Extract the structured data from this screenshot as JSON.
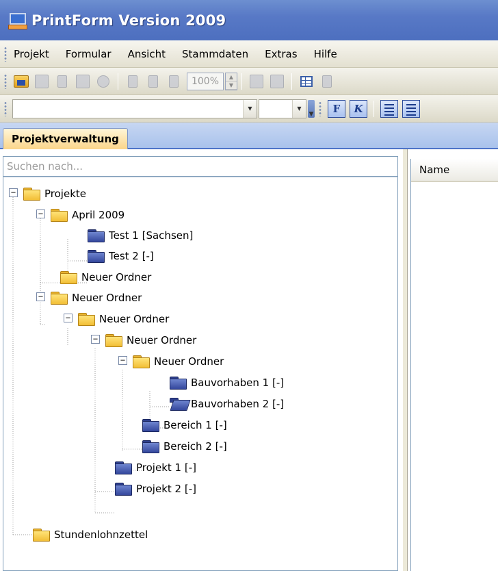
{
  "window": {
    "title": "PrintForm Version 2009"
  },
  "menu": [
    "Projekt",
    "Formular",
    "Ansicht",
    "Stammdaten",
    "Extras",
    "Hilfe"
  ],
  "toolbar": {
    "zoom": "100%"
  },
  "format_toolbar": {
    "bold_label": "F",
    "italic_label": "K"
  },
  "tabs": [
    "Projektverwaltung"
  ],
  "search": {
    "placeholder": "Suchen nach..."
  },
  "right_panel": {
    "column_header": "Name"
  },
  "tree": [
    {
      "label": "Projekte",
      "folder": "yellow",
      "expanded": true
    },
    {
      "label": "April 2009",
      "folder": "yellow",
      "expanded": true
    },
    {
      "label": "Test 1 [Sachsen]",
      "folder": "blue"
    },
    {
      "label": "Test 2 [-]",
      "folder": "blue"
    },
    {
      "label": "Neuer Ordner",
      "folder": "yellow"
    },
    {
      "label": "Neuer Ordner",
      "folder": "yellow",
      "expanded": true
    },
    {
      "label": "Neuer Ordner",
      "folder": "yellow",
      "expanded": true
    },
    {
      "label": "Neuer Ordner",
      "folder": "yellow",
      "expanded": true
    },
    {
      "label": "Neuer Ordner",
      "folder": "yellow",
      "expanded": true
    },
    {
      "label": "Bauvorhaben 1 [-]",
      "folder": "blue"
    },
    {
      "label": "Bauvorhaben 2 [-]",
      "folder": "blue-open"
    },
    {
      "label": "Bereich 1 [-]",
      "folder": "blue"
    },
    {
      "label": "Bereich 2 [-]",
      "folder": "blue"
    },
    {
      "label": "Projekt 1 [-]",
      "folder": "blue"
    },
    {
      "label": "Projekt 2 [-]",
      "folder": "blue"
    },
    {
      "label": "Stundenlohnzettel",
      "folder": "yellow"
    }
  ]
}
